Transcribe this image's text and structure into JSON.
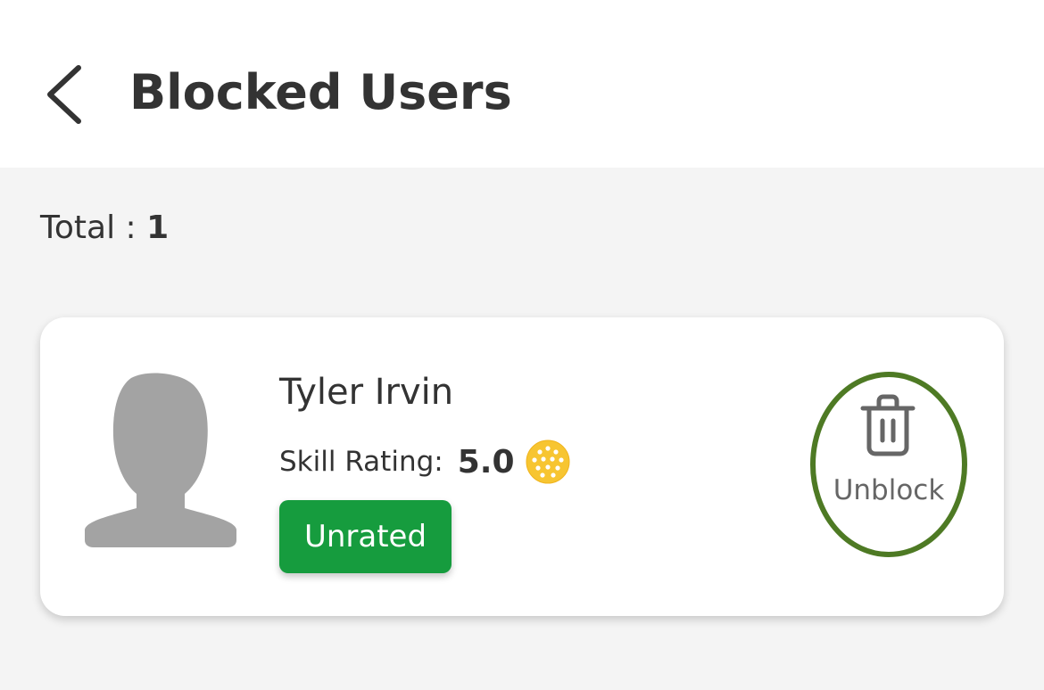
{
  "header": {
    "title": "Blocked Users",
    "back_icon": "chevron-left-icon"
  },
  "summary": {
    "total_label": "Total : ",
    "total_value": "1"
  },
  "blocked_users": [
    {
      "name": "Tyler Irvin",
      "avatar_icon": "default-user-silhouette",
      "skill_label": "Skill Rating:",
      "skill_value": "5.0",
      "skill_icon": "pickleball-icon",
      "badge": "Unrated",
      "action_icon": "trash-icon",
      "action_label": "Unblock"
    }
  ],
  "colors": {
    "header_bg": "#ffffff",
    "page_bg": "#f4f4f4",
    "badge_green": "#169c3e",
    "highlight_ring": "#4e7a24",
    "ball_yellow": "#f7c531",
    "avatar_gray": "#a3a3a3"
  }
}
